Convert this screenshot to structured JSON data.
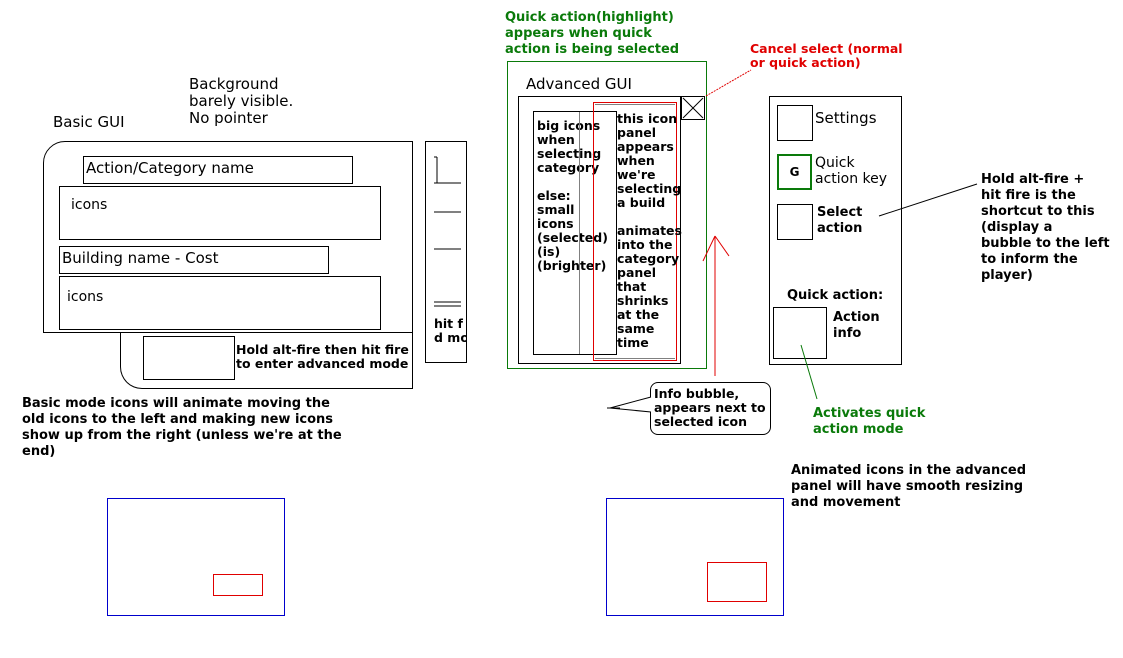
{
  "basic_gui": {
    "title": "Basic GUI",
    "background_note": "Background\nbarely visible.\nNo pointer",
    "action_category_label": "Action/Category name",
    "icons_row_1": "icons",
    "building_label": "Building name - Cost",
    "icons_row_2": "icons",
    "advanced_hint": "Hold alt-fire then hit fire\nto enter advanced mode",
    "side_strip_text": "hit f\nd mo",
    "animation_note": "Basic mode icons will animate moving the\nold icons to the left and making new icons\nshow up from the right (unless we're at the\nend)"
  },
  "advanced_gui": {
    "highlight_note": "Quick action(highlight)\nappears when quick\naction is being selected",
    "title": "Advanced GUI",
    "cancel_note": "Cancel select (normal\nor quick action)",
    "close_icon": "close-x",
    "category_panel_text": "big icons\nwhen\nselecting\ncategory\n\nelse:\nsmall\nicons\n(selected)\n(is)\n(brighter)",
    "icon_panel_text": "this icon\npanel\nappears\nwhen\nwe're\nselecting\na build\n\nanimates\ninto the\ncategory\npanel\nthat\nshrinks\nat the\nsame\ntime",
    "info_bubble": "Info bubble,\nappears next to\nselected icon",
    "animated_note": "Animated icons in the advanced\npanel will have smooth resizing\nand movement"
  },
  "side_panel": {
    "settings_label": "Settings",
    "quick_key_glyph": "G",
    "quick_key_label": "Quick\naction key",
    "select_label": "Select\naction",
    "quick_action_heading": "Quick action:",
    "action_info_label": "Action\ninfo",
    "shortcut_note": "Hold alt-fire +\nhit fire is the\nshortcut to this\n(display a\nbubble to the left\nto inform the\nplayer)",
    "activates_note": "Activates quick\naction mode"
  },
  "colors": {
    "green": "#0a7a0a",
    "red": "#e00000",
    "blue": "#0000cc",
    "gray": "#808080"
  }
}
